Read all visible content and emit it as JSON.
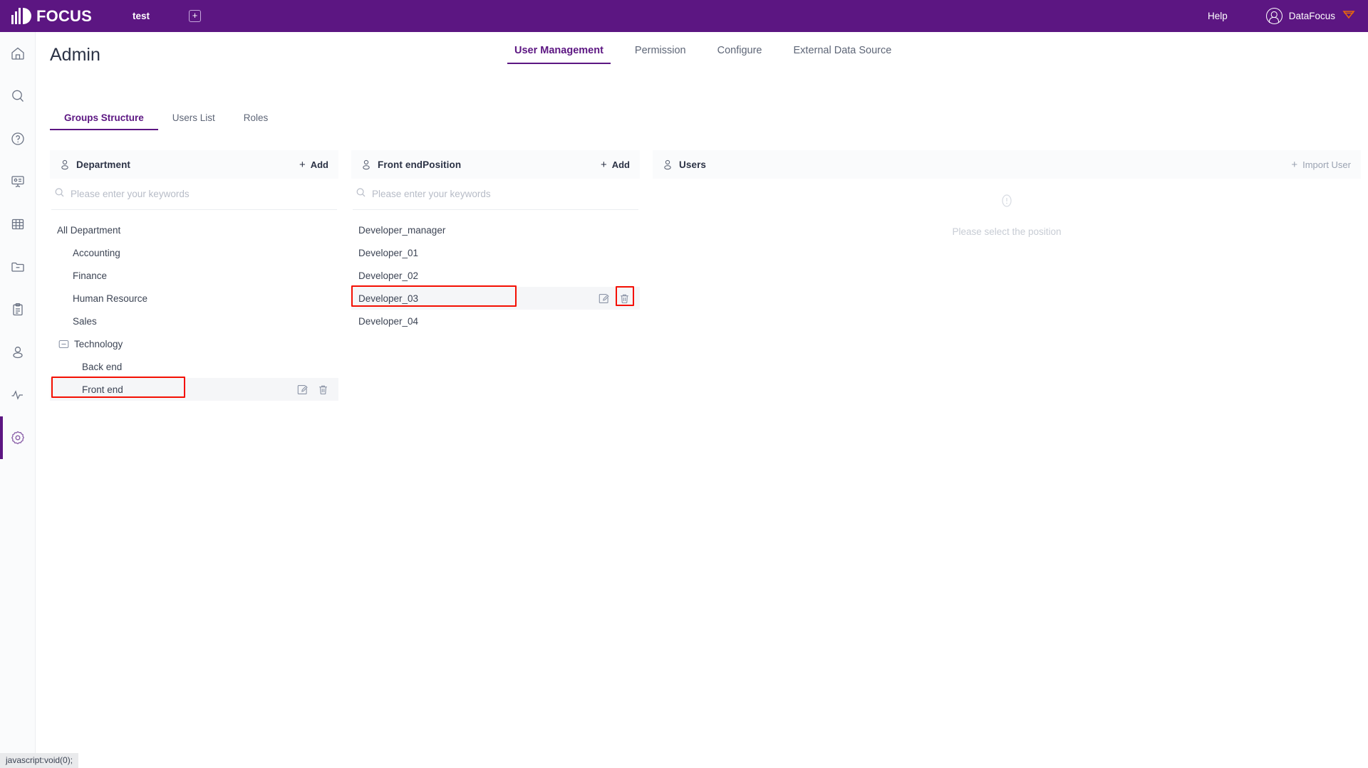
{
  "header": {
    "brand": "FOCUS",
    "brand_icon": "focus-logo-icon",
    "workspace_tab": "test",
    "add_tab_label": "+",
    "help_label": "Help",
    "user_name": "DataFocus",
    "accent_color": "#5C1682",
    "badge_color": "#E8670C"
  },
  "sidebar": {
    "items": [
      {
        "name": "home",
        "icon": "home-icon",
        "active": false
      },
      {
        "name": "search",
        "icon": "search-icon",
        "active": false
      },
      {
        "name": "help",
        "icon": "question-circle-icon",
        "active": false
      },
      {
        "name": "board",
        "icon": "presentation-icon",
        "active": false
      },
      {
        "name": "table",
        "icon": "grid-table-icon",
        "active": false
      },
      {
        "name": "folder",
        "icon": "folder-minus-icon",
        "active": false
      },
      {
        "name": "tasks",
        "icon": "clipboard-icon",
        "active": false
      },
      {
        "name": "profile",
        "icon": "user-icon",
        "active": false
      },
      {
        "name": "monitor",
        "icon": "activity-pulse-icon",
        "active": false
      },
      {
        "name": "settings",
        "icon": "gear-icon",
        "active": true
      }
    ]
  },
  "page": {
    "title": "Admin",
    "nav_tabs": [
      {
        "label": "User Management",
        "active": true
      },
      {
        "label": "Permission",
        "active": false
      },
      {
        "label": "Configure",
        "active": false
      },
      {
        "label": "External Data Source",
        "active": false
      }
    ],
    "sub_tabs": [
      {
        "label": "Groups Structure",
        "active": true
      },
      {
        "label": "Users List",
        "active": false
      },
      {
        "label": "Roles",
        "active": false
      }
    ]
  },
  "department_panel": {
    "title": "Department",
    "header_icon": "user-outline-icon",
    "add_label": "Add",
    "add_icon": "plus-icon",
    "search_placeholder": "Please enter your keywords",
    "search_value": "",
    "search_icon": "search-icon",
    "tree": [
      {
        "label": "All Department",
        "indent": 0,
        "toggle": "none",
        "hovered": false,
        "highlighted": false
      },
      {
        "label": "Accounting",
        "indent": 1,
        "toggle": "none",
        "hovered": false,
        "highlighted": false
      },
      {
        "label": "Finance",
        "indent": 1,
        "toggle": "none",
        "hovered": false,
        "highlighted": false
      },
      {
        "label": "Human Resource",
        "indent": 1,
        "toggle": "none",
        "hovered": false,
        "highlighted": false
      },
      {
        "label": "Sales",
        "indent": 1,
        "toggle": "none",
        "hovered": false,
        "highlighted": false
      },
      {
        "label": "Technology",
        "indent": 1,
        "toggle": "minus",
        "hovered": false,
        "highlighted": false
      },
      {
        "label": "Back end",
        "indent": 2,
        "toggle": "none",
        "hovered": false,
        "highlighted": false
      },
      {
        "label": "Front end",
        "indent": 2,
        "toggle": "none",
        "hovered": true,
        "highlighted": true
      }
    ],
    "row_actions": {
      "edit_icon": "edit-pencil-icon",
      "delete_icon": "trash-icon"
    }
  },
  "position_panel": {
    "title": "Front endPosition",
    "header_icon": "user-outline-icon",
    "add_label": "Add",
    "add_icon": "plus-icon",
    "search_placeholder": "Please enter your keywords",
    "search_value": "",
    "search_icon": "search-icon",
    "items": [
      {
        "label": "Developer_manager",
        "hovered": false,
        "highlighted": false,
        "delete_highlighted": false
      },
      {
        "label": "Developer_01",
        "hovered": false,
        "highlighted": false,
        "delete_highlighted": false
      },
      {
        "label": "Developer_02",
        "hovered": false,
        "highlighted": false,
        "delete_highlighted": false
      },
      {
        "label": "Developer_03",
        "hovered": true,
        "highlighted": true,
        "delete_highlighted": true
      },
      {
        "label": "Developer_04",
        "hovered": false,
        "highlighted": false,
        "delete_highlighted": false
      }
    ],
    "row_actions": {
      "edit_icon": "edit-pencil-icon",
      "delete_icon": "trash-icon"
    }
  },
  "users_panel": {
    "title": "Users",
    "header_icon": "user-outline-icon",
    "import_label": "Import User",
    "import_icon": "plus-icon",
    "empty_icon": "info-circle-icon",
    "empty_text": "Please select the position"
  },
  "status_bar": {
    "text": "javascript:void(0);"
  }
}
